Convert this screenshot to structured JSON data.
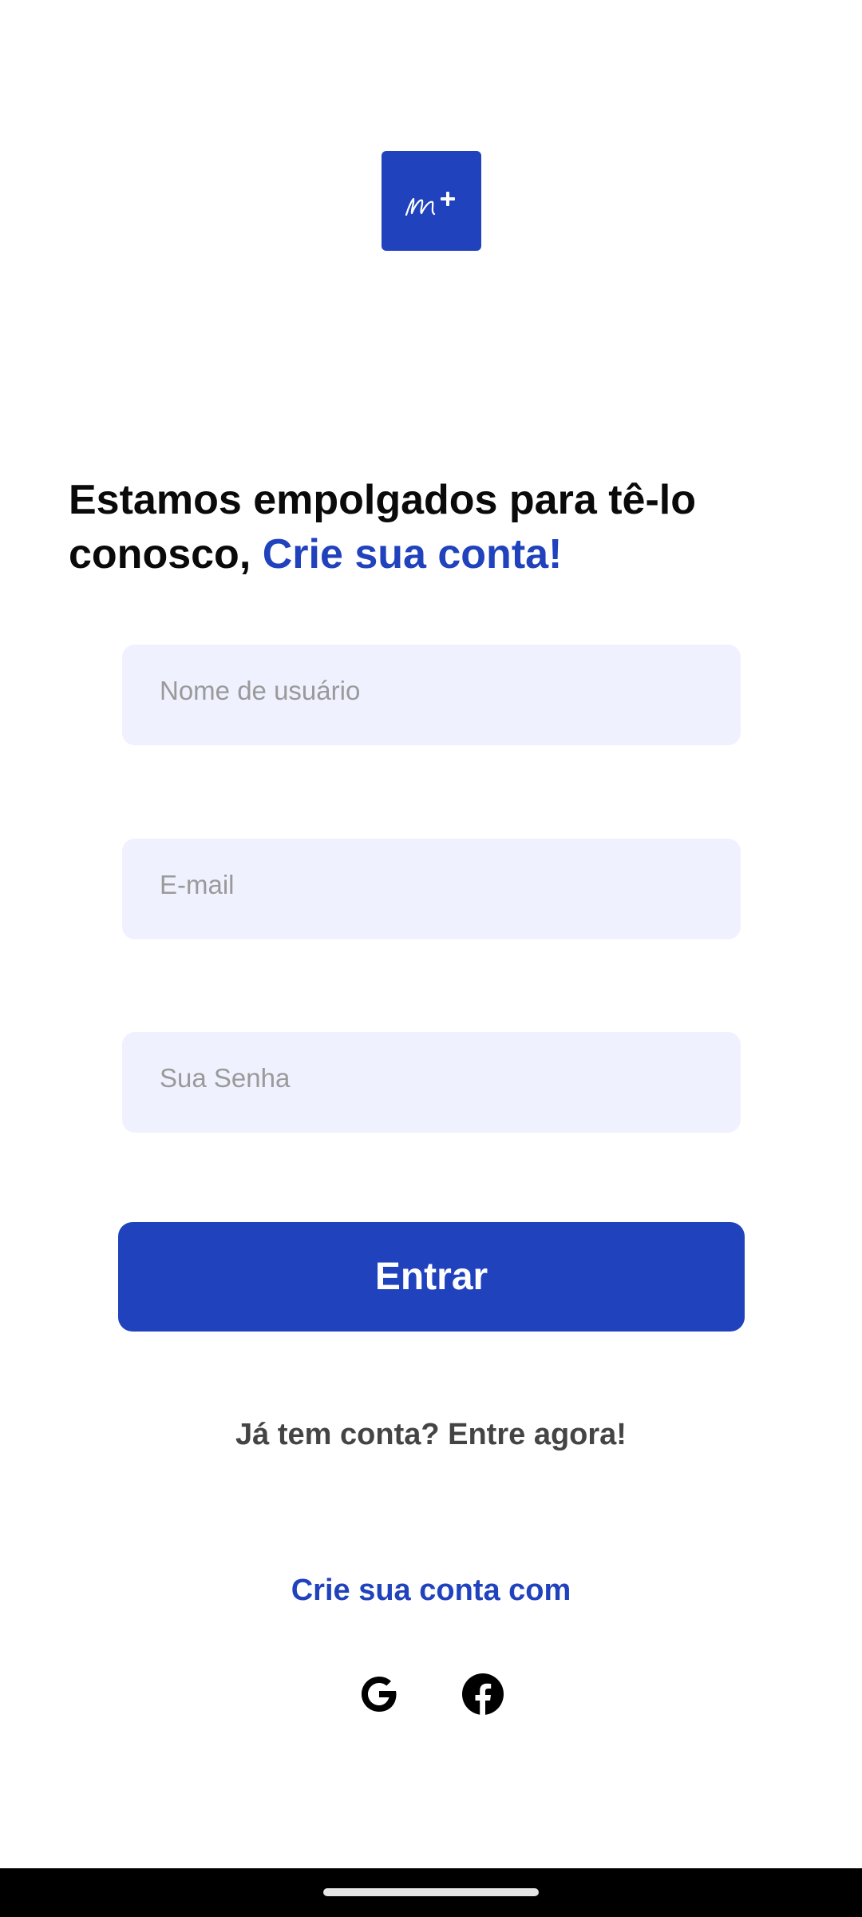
{
  "logo": {
    "icon": "m-plus-logo",
    "color": "#2042bd"
  },
  "headline": {
    "line1": "Estamos empolgados para tê-lo",
    "line2_prefix": "conosco, ",
    "line2_accent": "Crie sua conta!"
  },
  "form": {
    "username_placeholder": "Nome de usuário",
    "email_placeholder": "E-mail",
    "password_placeholder": "Sua Senha",
    "submit_label": "Entrar"
  },
  "login_prompt": "Já tem conta? Entre agora!",
  "social": {
    "title": "Crie sua conta com",
    "providers": [
      {
        "name": "Google",
        "icon": "google-icon"
      },
      {
        "name": "Facebook",
        "icon": "facebook-icon"
      }
    ]
  },
  "colors": {
    "accent": "#2042bd",
    "field_bg": "#eff1fe",
    "text": "#0a0a0a",
    "muted": "#444444"
  }
}
